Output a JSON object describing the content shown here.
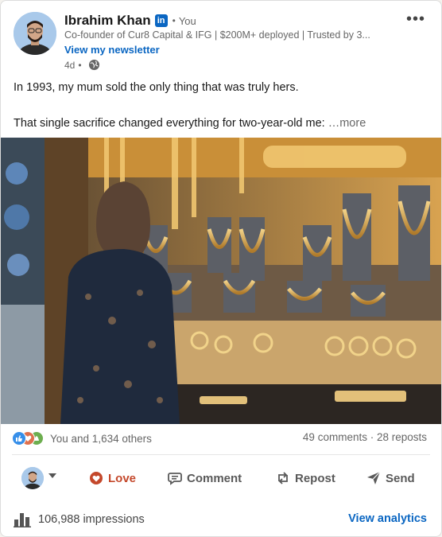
{
  "post": {
    "author_name": "Ibrahim Khan",
    "badge": "in",
    "separator": "•",
    "you_label": "You",
    "subtitle": "Co-founder of Cur8 Capital & IFG | $200M+ deployed | Trusted by 3...",
    "newsletter_link": "View my newsletter",
    "age": "4d",
    "age_separator": "•",
    "visibility_icon": "globe-icon",
    "menu_icon": "more-options-icon",
    "menu_glyph": "•••",
    "text_line1": "In 1993, my mum sold the only thing that was truly hers.",
    "text_line2": "That single sacrifice changed everything for two-year-old me:",
    "see_more": "…more",
    "image_description_icon": "photo"
  },
  "social": {
    "reaction_icons": [
      "like-icon",
      "love-icon",
      "celebrate-icon"
    ],
    "reactions_label": "You and 1,634 others",
    "comments_reposts": "49 comments · 28 reposts"
  },
  "actions": {
    "love_label": "Love",
    "comment_label": "Comment",
    "repost_label": "Repost",
    "send_label": "Send",
    "love_color": "#c4482b"
  },
  "footer": {
    "impressions_label": "106,988 impressions",
    "analytics_label": "View analytics"
  },
  "colors": {
    "brand_blue": "#0a66c2",
    "text_muted": "#666666"
  }
}
